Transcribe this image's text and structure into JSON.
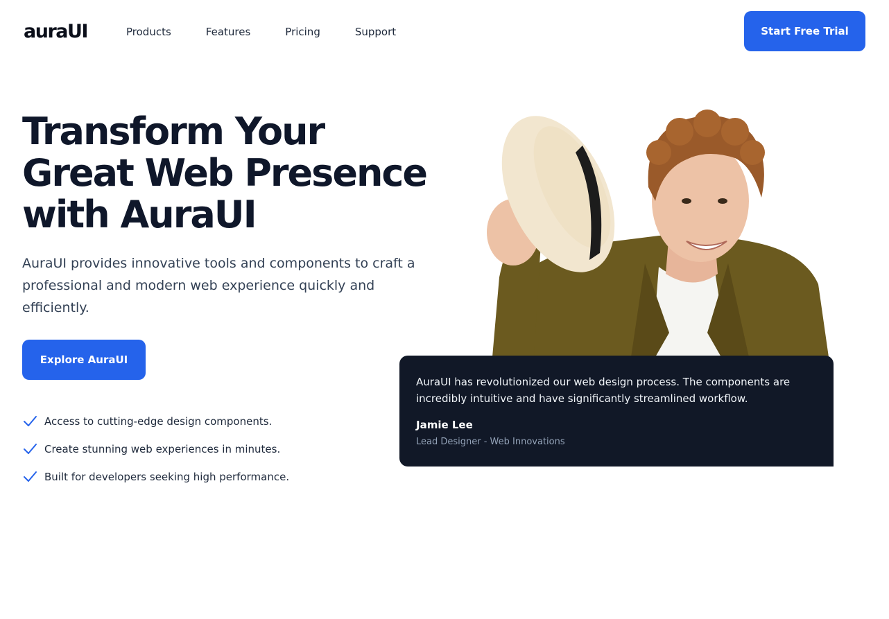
{
  "header": {
    "logo": "auraUI",
    "nav": [
      "Products",
      "Features",
      "Pricing",
      "Support"
    ],
    "cta_label": "Start Free Trial"
  },
  "hero": {
    "title_lines": [
      "Transform Your",
      "Great Web Presence",
      "with AuraUI"
    ],
    "description": "AuraUI provides innovative tools and components to craft a professional and modern web experience quickly and efficiently.",
    "button_label": "Explore AuraUI",
    "features": [
      "Access to cutting-edge design components.",
      "Create stunning web experiences in minutes.",
      "Built for developers seeking high performance."
    ]
  },
  "testimonial": {
    "quote": "AuraUI has revolutionized our web design process. The components are incredibly intuitive and have significantly streamlined workflow.",
    "author": "Jamie Lee",
    "role": "Lead Designer - Web Innovations"
  },
  "colors": {
    "accent": "#2563eb",
    "dark": "#111827",
    "heading": "#0f172a"
  },
  "icons": {
    "feature_check": "check-icon"
  }
}
